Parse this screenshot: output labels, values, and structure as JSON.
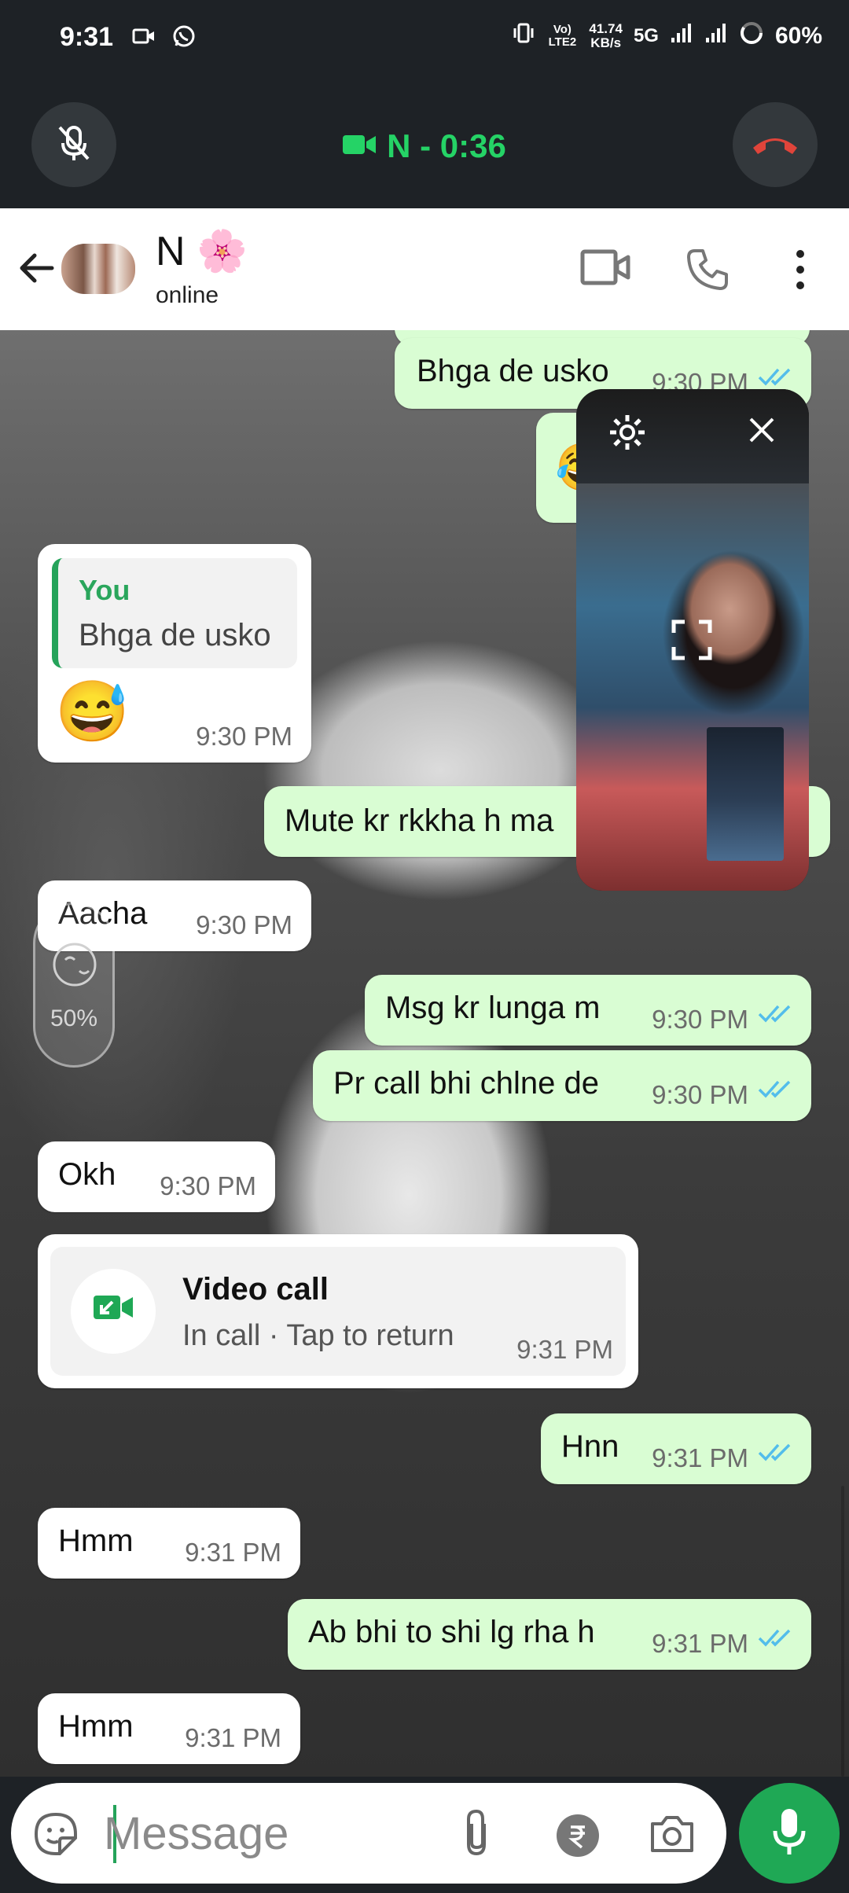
{
  "status_bar": {
    "time": "9:31",
    "network_label_top": "Vo) LTE2",
    "speed_value": "41.74",
    "speed_unit": "KB/s",
    "network_type": "5G",
    "battery": "60%"
  },
  "call": {
    "status": "N - 0:36",
    "accent_color": "#25d366",
    "end_color": "#e0443a"
  },
  "header": {
    "contact_name": "N 🌸",
    "status": "online"
  },
  "messages": {
    "m1": {
      "text": "Bhga de usko",
      "time": "9:30 PM"
    },
    "m2": {
      "text": "😂",
      "time": ""
    },
    "m3": {
      "reply_name": "You",
      "reply_text": "Bhga de usko",
      "emoji": "😅",
      "time": "9:30 PM"
    },
    "m4": {
      "text": "Mute kr rkkha h ma",
      "time": ""
    },
    "m5": {
      "text": "Aacha",
      "time": "9:30 PM"
    },
    "m6": {
      "text": "Msg kr lunga m",
      "time": "9:30 PM"
    },
    "m7": {
      "text": "Pr call bhi chlne de",
      "time": "9:30 PM"
    },
    "m8": {
      "text": "Okh",
      "time": "9:30 PM"
    },
    "m9": {
      "title": "Video call",
      "subtitle": "In call · Tap to return",
      "time": "9:31 PM"
    },
    "m10": {
      "text": "Hnn",
      "time": "9:31 PM"
    },
    "m11": {
      "text": "Hmm",
      "time": "9:31 PM"
    },
    "m12": {
      "text": "Ab bhi to shi lg rha h",
      "time": "9:31 PM"
    },
    "m13": {
      "text": "Hmm",
      "time": "9:31 PM"
    }
  },
  "brightness": {
    "value": "50%"
  },
  "composer": {
    "placeholder": "Message"
  },
  "colors": {
    "outgoing": "#d9fdd3",
    "incoming": "#ffffff",
    "ticks": "#53bdeb",
    "brand_green": "#1fa855"
  }
}
